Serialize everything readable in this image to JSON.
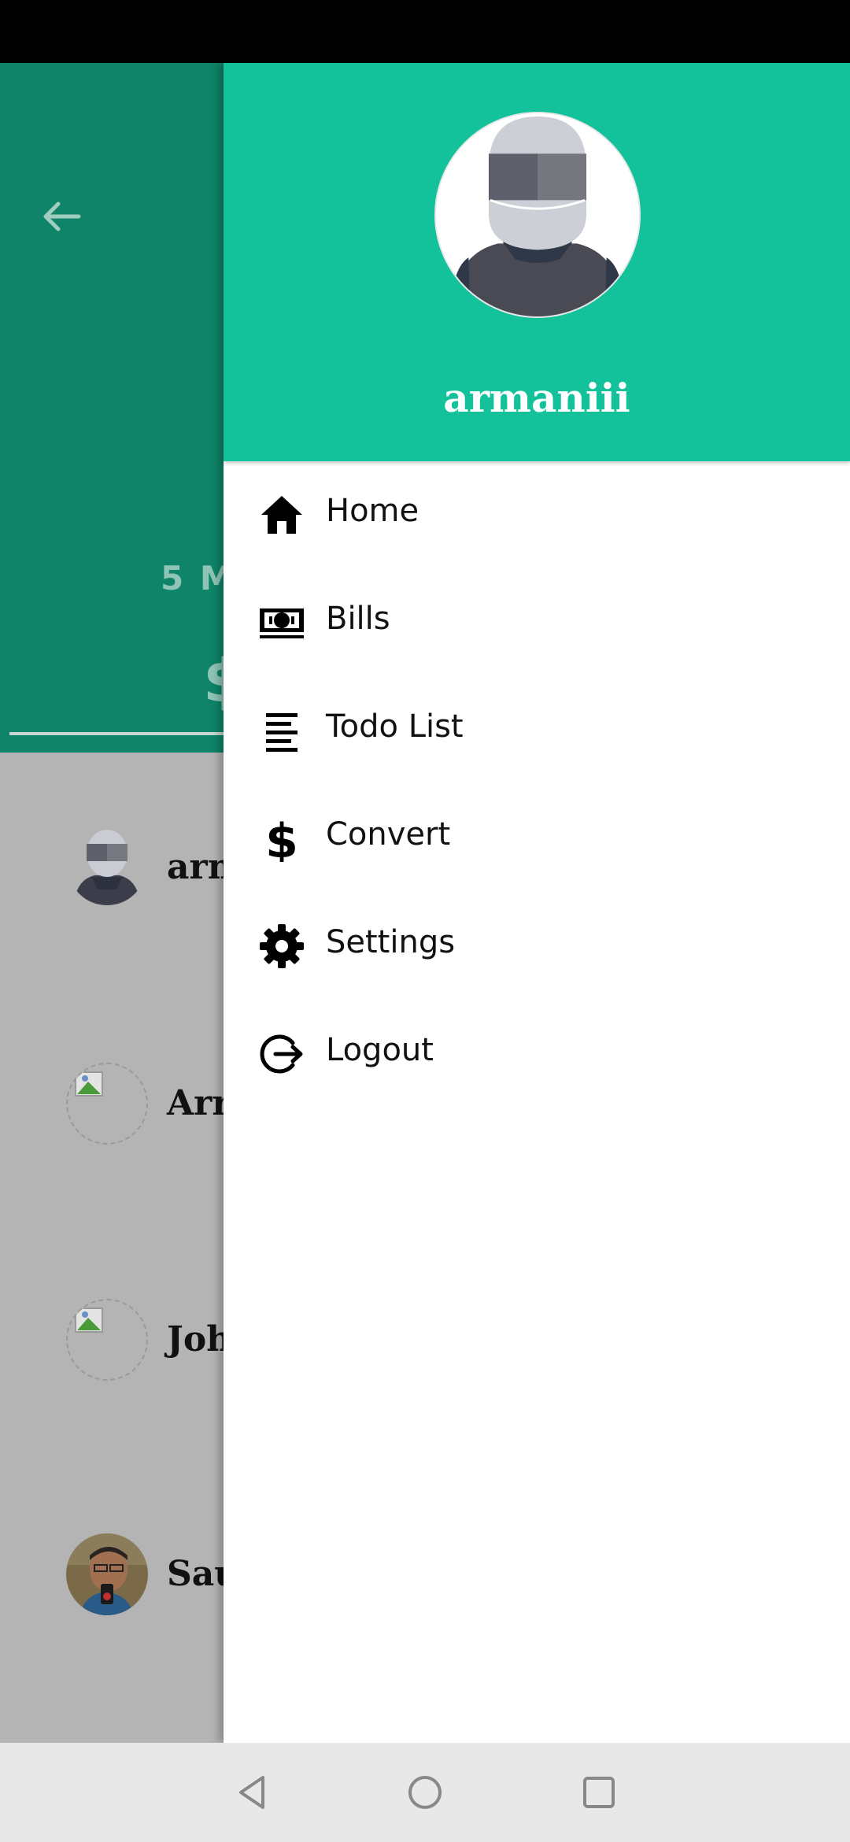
{
  "background": {
    "period_text": "5 M",
    "amount_text": "$",
    "rows": [
      {
        "name": "arm",
        "avatar": "helmet-avatar"
      },
      {
        "name": "Arr",
        "avatar": "broken-image"
      },
      {
        "name": "Joh",
        "avatar": "broken-image"
      },
      {
        "name": "Sau",
        "avatar": "photo-avatar"
      }
    ]
  },
  "drawer": {
    "username": "armaniii",
    "items": [
      {
        "label": "Home",
        "icon": "home-icon"
      },
      {
        "label": "Bills",
        "icon": "bills-icon"
      },
      {
        "label": "Todo List",
        "icon": "todo-list-icon"
      },
      {
        "label": "Convert",
        "icon": "dollar-icon"
      },
      {
        "label": "Settings",
        "icon": "gear-icon"
      },
      {
        "label": "Logout",
        "icon": "logout-icon"
      }
    ]
  },
  "colors": {
    "drawer_header": "#13c29a",
    "bg_header": "#0f8468",
    "scrim": "#b4b4b4"
  }
}
